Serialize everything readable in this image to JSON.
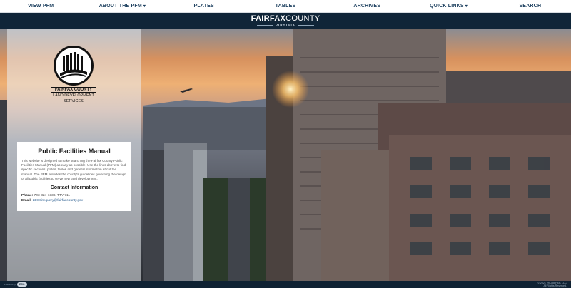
{
  "nav": {
    "items": [
      {
        "label": "VIEW PFM",
        "dropdown": false
      },
      {
        "label": "ABOUT THE PFM",
        "dropdown": true
      },
      {
        "label": "PLATES",
        "dropdown": false
      },
      {
        "label": "TABLES",
        "dropdown": false
      },
      {
        "label": "ARCHIVES",
        "dropdown": false
      },
      {
        "label": "QUICK LINKS",
        "dropdown": true
      },
      {
        "label": "SEARCH",
        "dropdown": false
      }
    ],
    "caret": "▾"
  },
  "brand": {
    "name_bold": "FAIRFAX",
    "name_thin": "COUNTY",
    "sub": "VIRGINIA"
  },
  "logo": {
    "org_top": "FAIRFAX COUNTY",
    "org_line1": "LAND DEVELOPMENT",
    "org_line2": "SERVICES"
  },
  "card": {
    "title": "Public Facilities Manual",
    "description": "This website is designed to make searching the Fairfax County Public Facilities Manual (PFM) as easy as possible. Use the links above to find specific sections, plates, tables and general information about the manual. The PFM provides the county's guidelines governing the design of all public facilities to serve new land development.",
    "contact_heading": "Contact Information",
    "phone_label": "Phone:",
    "phone": "703-324-1336, TTY 711",
    "email_label": "Email:",
    "email": "LDSSitequery@fairfaxcounty.gov"
  },
  "footer": {
    "powered_label": "Powered by",
    "powered_badge": "ECO",
    "copyright": "© 2021 enCodePlus, LLC",
    "rights": "All Rights Reserved."
  },
  "colors": {
    "nav_text": "#1c3f5e",
    "brand_bar": "#102538",
    "footer": "#0f2233"
  }
}
